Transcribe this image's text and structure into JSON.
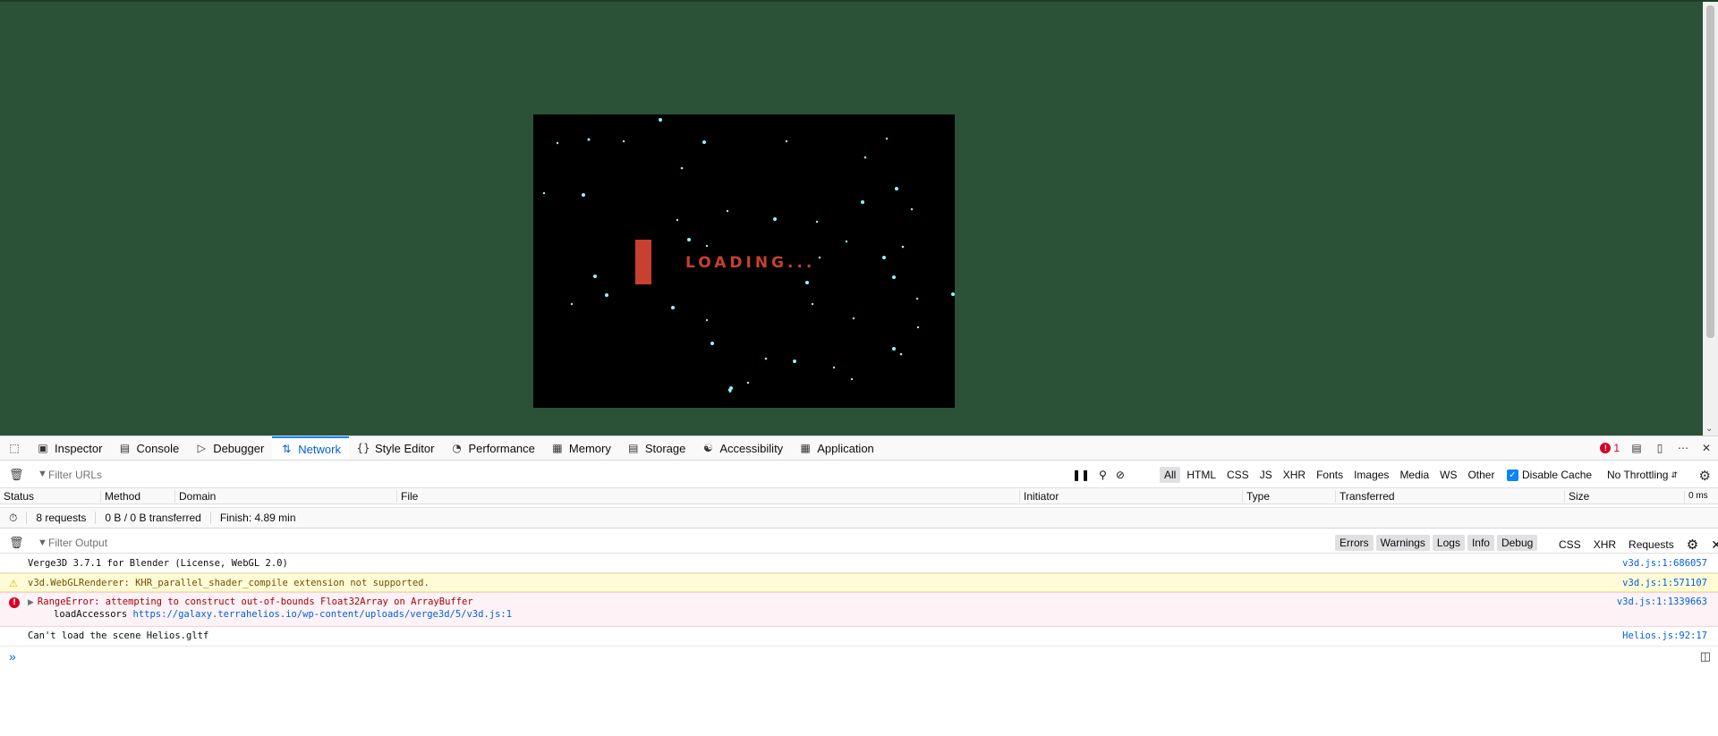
{
  "canvas": {
    "loading_text": "LOADING...",
    "bar_color": "#c8402f",
    "star_color": "#8ff5ff"
  },
  "devtools": {
    "tabs": [
      {
        "label": "Inspector",
        "icon": "inspector-icon"
      },
      {
        "label": "Console",
        "icon": "console-icon"
      },
      {
        "label": "Debugger",
        "icon": "debugger-icon"
      },
      {
        "label": "Network",
        "icon": "network-icon",
        "active": true
      },
      {
        "label": "Style Editor",
        "icon": "style-editor-icon"
      },
      {
        "label": "Performance",
        "icon": "performance-icon"
      },
      {
        "label": "Memory",
        "icon": "memory-icon"
      },
      {
        "label": "Storage",
        "icon": "storage-icon"
      },
      {
        "label": "Accessibility",
        "icon": "accessibility-icon"
      },
      {
        "label": "Application",
        "icon": "application-icon"
      }
    ],
    "error_count": "1"
  },
  "network": {
    "filter_placeholder": "Filter URLs",
    "type_filters": [
      "All",
      "HTML",
      "CSS",
      "JS",
      "XHR",
      "Fonts",
      "Images",
      "Media",
      "WS",
      "Other"
    ],
    "disable_cache_label": "Disable Cache",
    "throttling": "No Throttling",
    "columns": [
      "Status",
      "Method",
      "Domain",
      "File",
      "Initiator",
      "Type",
      "Transferred",
      "Size"
    ],
    "timeline_label": "0 ms",
    "summary": {
      "requests": "8 requests",
      "transferred": "0 B / 0 B transferred",
      "finish": "Finish: 4.89 min"
    }
  },
  "console": {
    "filter_placeholder": "Filter Output",
    "levels": [
      "Errors",
      "Warnings",
      "Logs",
      "Info",
      "Debug"
    ],
    "extra": [
      "CSS",
      "XHR",
      "Requests"
    ],
    "messages": [
      {
        "level": "log",
        "text": "Verge3D 3.7.1 for Blender (License, WebGL 2.0)",
        "source": "v3d.js:1:686057"
      },
      {
        "level": "warn",
        "text": "v3d.WebGLRenderer: KHR_parallel_shader_compile extension not supported.",
        "source": "v3d.js:1:571107"
      },
      {
        "level": "error",
        "text": "RangeError: attempting to construct out-of-bounds Float32Array on ArrayBuffer",
        "source": "v3d.js:1:1339663",
        "stack_fn": "loadAccessors",
        "stack_url": "https://galaxy.terrahelios.io/wp-content/uploads/verge3d/5/v3d.js:1"
      },
      {
        "level": "log",
        "text": "Can't load the scene Helios.gltf",
        "source": "Helios.js:92:17"
      }
    ]
  }
}
